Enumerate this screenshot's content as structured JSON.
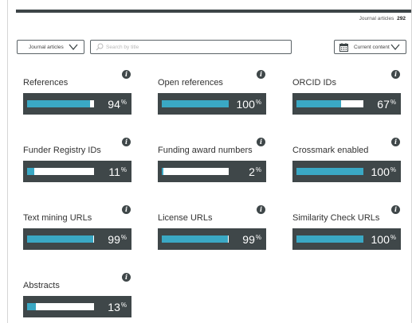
{
  "header": {
    "count_label": "Journal articles",
    "count_value": "292"
  },
  "filters": {
    "type_select": "Journal articles",
    "search_placeholder": "Search by title",
    "content_select": "Current content"
  },
  "icons": {
    "info": "info-icon",
    "search": "search-icon",
    "calendar": "calendar-icon",
    "chevron": "chevron-down-icon"
  },
  "colors": {
    "bar_fill": "#3aa8c4",
    "panel": "#3f4749",
    "track": "#ffffff"
  },
  "metrics": [
    {
      "label": "References",
      "value": "94",
      "unit": "%",
      "fill_fraction": 0.94
    },
    {
      "label": "Open references",
      "value": "100",
      "unit": "%",
      "fill_fraction": 1.0
    },
    {
      "label": "ORCID IDs",
      "value": "67",
      "unit": "%",
      "fill_fraction": 0.67
    },
    {
      "label": "Funder Registry IDs",
      "value": "11",
      "unit": "%",
      "fill_fraction": 0.11
    },
    {
      "label": "Funding award numbers",
      "value": "2",
      "unit": "%",
      "fill_fraction": 0.02
    },
    {
      "label": "Crossmark enabled",
      "value": "100",
      "unit": "%",
      "fill_fraction": 1.0
    },
    {
      "label": "Text mining URLs",
      "value": "99",
      "unit": "%",
      "fill_fraction": 0.99
    },
    {
      "label": "License URLs",
      "value": "99",
      "unit": "%",
      "fill_fraction": 0.99
    },
    {
      "label": "Similarity Check URLs",
      "value": "100",
      "unit": "%",
      "fill_fraction": 1.0
    },
    {
      "label": "Abstracts",
      "value": "13",
      "unit": "%",
      "fill_fraction": 0.13
    }
  ]
}
